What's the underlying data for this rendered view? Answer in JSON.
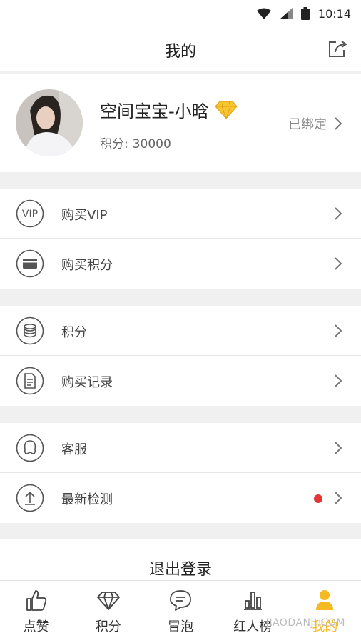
{
  "status_bar": {
    "time": "10:14",
    "icons": [
      "wifi-icon",
      "signal-icon",
      "battery-icon"
    ]
  },
  "header": {
    "title": "我的",
    "share_icon": "share-icon"
  },
  "profile": {
    "name": "空间宝宝-小晗",
    "badge_icon": "diamond-icon",
    "points_label": "积分:",
    "points_value": "30000",
    "bind_status": "已绑定"
  },
  "menu": {
    "group1": [
      {
        "label": "购买VIP",
        "icon": "vip-icon"
      },
      {
        "label": "购买积分",
        "icon": "card-icon"
      }
    ],
    "group2": [
      {
        "label": "积分",
        "icon": "coins-icon"
      },
      {
        "label": "购买记录",
        "icon": "document-icon"
      }
    ],
    "group3": [
      {
        "label": "客服",
        "icon": "customer-service-icon"
      },
      {
        "label": "最新检测",
        "icon": "upload-icon",
        "has_notification": true
      }
    ]
  },
  "logout_label": "退出登录",
  "tabs": [
    {
      "label": "点赞",
      "icon": "thumbs-up-icon",
      "active": false
    },
    {
      "label": "积分",
      "icon": "diamond-outline-icon",
      "active": false
    },
    {
      "label": "冒泡",
      "icon": "chat-bubble-icon",
      "active": false
    },
    {
      "label": "红人榜",
      "icon": "bar-chart-icon",
      "active": false
    },
    {
      "label": "我的",
      "icon": "person-icon",
      "active": true
    }
  ],
  "watermark": "JIAODANJI.COM",
  "colors": {
    "accent": "#f5b921",
    "notification_dot": "#e53535",
    "background": "#f0f0f0"
  }
}
